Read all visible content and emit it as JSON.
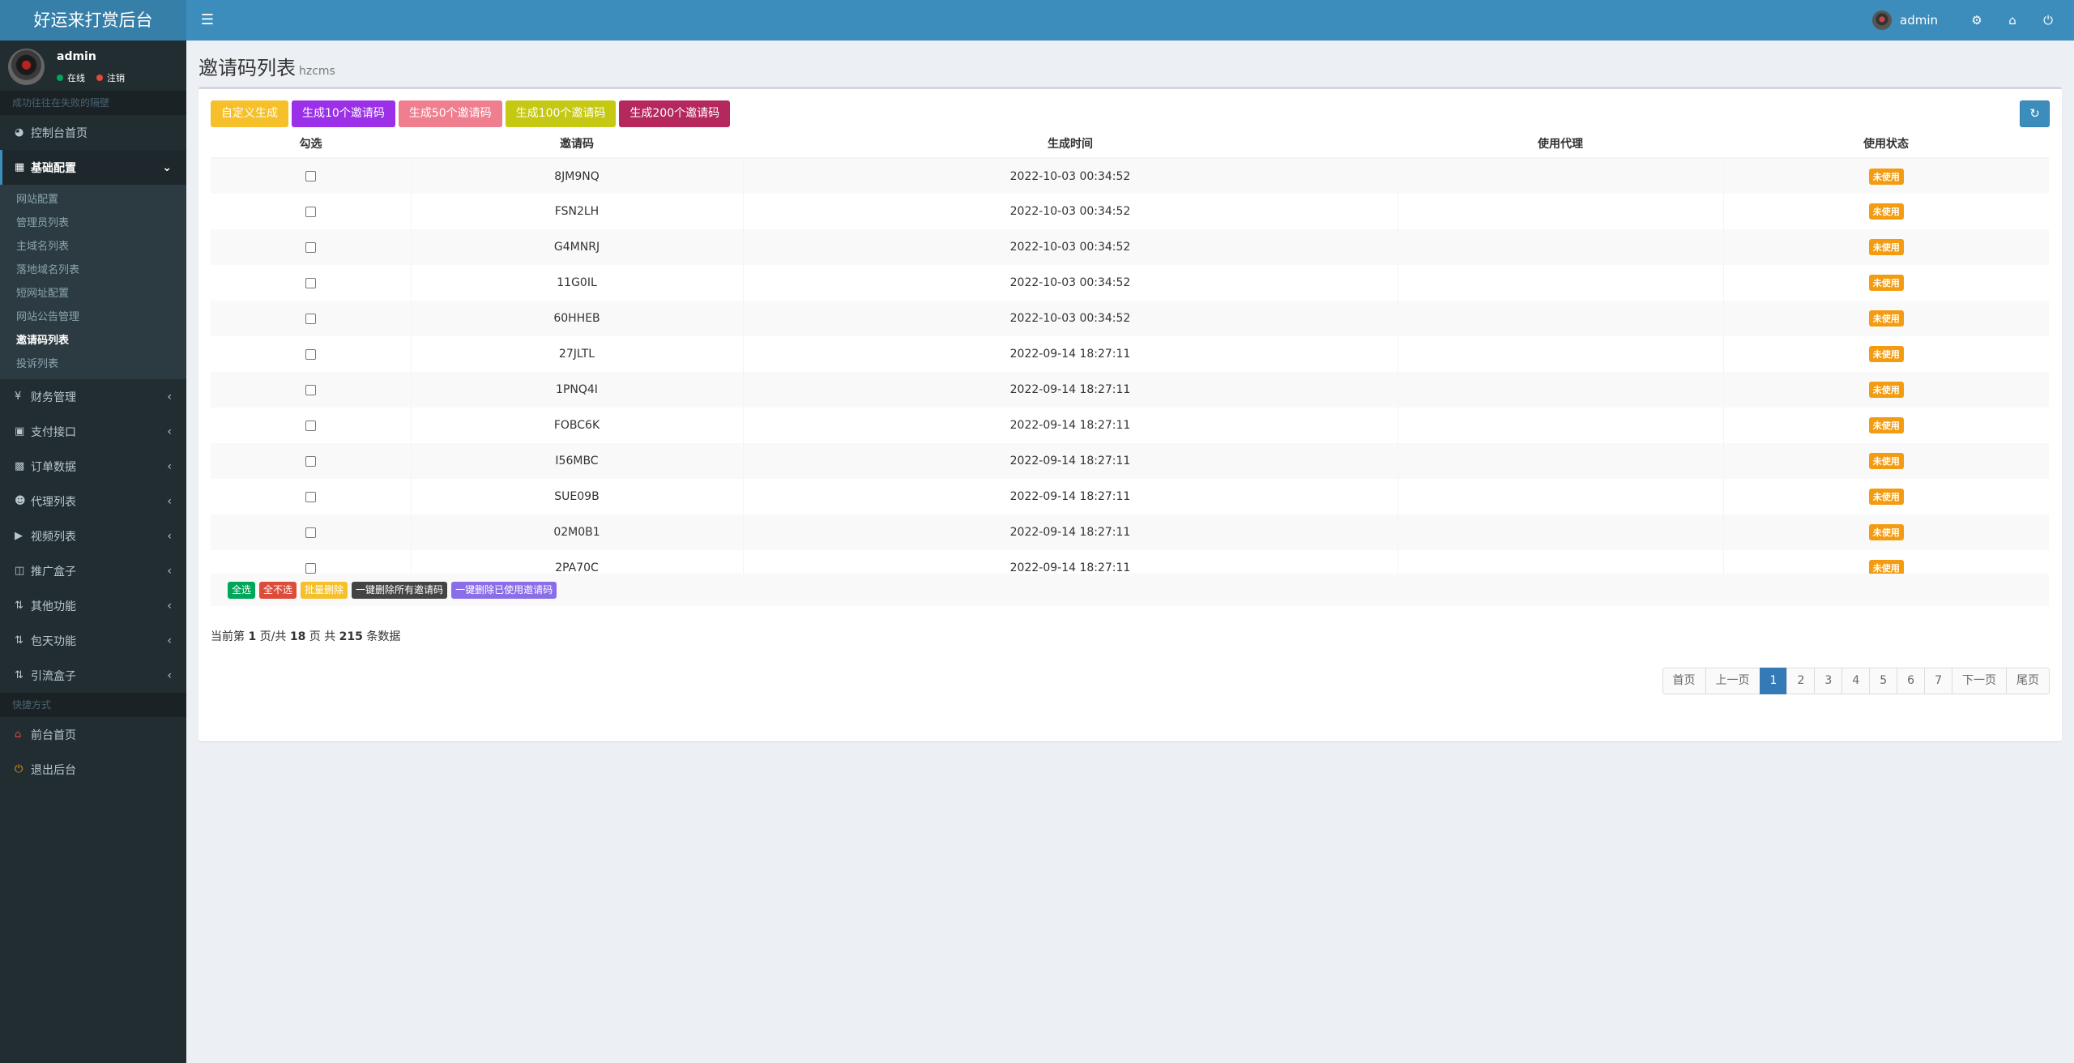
{
  "header": {
    "logo": "好运来打赏后台",
    "user": "admin"
  },
  "sidebar": {
    "user_name": "admin",
    "status_online": "在线",
    "status_logout": "注销",
    "hint": "成功往往在失败的隔壁",
    "items": [
      {
        "label": "控制台首页",
        "icon": "dashboard-icon"
      },
      {
        "label": "基础配置",
        "icon": "grid-icon"
      },
      {
        "label": "财务管理",
        "icon": "yen-icon"
      },
      {
        "label": "支付接口",
        "icon": "payment-icon"
      },
      {
        "label": "订单数据",
        "icon": "bar-chart-icon"
      },
      {
        "label": "代理列表",
        "icon": "users-icon"
      },
      {
        "label": "视频列表",
        "icon": "video-icon"
      },
      {
        "label": "推广盒子",
        "icon": "table-icon"
      },
      {
        "label": "其他功能",
        "icon": "retweet-icon"
      },
      {
        "label": "包天功能",
        "icon": "retweet-icon"
      },
      {
        "label": "引流盒子",
        "icon": "retweet-icon"
      }
    ],
    "submenu": [
      "网站配置",
      "管理员列表",
      "主域名列表",
      "落地域名列表",
      "短网址配置",
      "网站公告管理",
      "邀请码列表",
      "投诉列表"
    ],
    "quick_label": "快捷方式",
    "quick": [
      "前台首页",
      "退出后台"
    ]
  },
  "page": {
    "title": "邀请码列表",
    "subtitle": "hzcms"
  },
  "toolbar": {
    "buttons": [
      "自定义生成",
      "生成10个邀请码",
      "生成50个邀请码",
      "生成100个邀请码",
      "生成200个邀请码"
    ],
    "colors": [
      "#f6c02b",
      "#9b30e8",
      "#ef7f8f",
      "#c6c913",
      "#b5285d"
    ]
  },
  "table": {
    "headers": [
      "勾选",
      "邀请码",
      "生成时间",
      "使用代理",
      "使用状态"
    ],
    "rows": [
      {
        "code": "8JM9NQ",
        "time": "2022-10-03 00:34:52",
        "agent": "",
        "status": "未使用"
      },
      {
        "code": "FSN2LH",
        "time": "2022-10-03 00:34:52",
        "agent": "",
        "status": "未使用"
      },
      {
        "code": "G4MNRJ",
        "time": "2022-10-03 00:34:52",
        "agent": "",
        "status": "未使用"
      },
      {
        "code": "11G0IL",
        "time": "2022-10-03 00:34:52",
        "agent": "",
        "status": "未使用"
      },
      {
        "code": "60HHEB",
        "time": "2022-10-03 00:34:52",
        "agent": "",
        "status": "未使用"
      },
      {
        "code": "27JLTL",
        "time": "2022-09-14 18:27:11",
        "agent": "",
        "status": "未使用"
      },
      {
        "code": "1PNQ4I",
        "time": "2022-09-14 18:27:11",
        "agent": "",
        "status": "未使用"
      },
      {
        "code": "FOBC6K",
        "time": "2022-09-14 18:27:11",
        "agent": "",
        "status": "未使用"
      },
      {
        "code": "I56MBC",
        "time": "2022-09-14 18:27:11",
        "agent": "",
        "status": "未使用"
      },
      {
        "code": "SUE09B",
        "time": "2022-09-14 18:27:11",
        "agent": "",
        "status": "未使用"
      },
      {
        "code": "02M0B1",
        "time": "2022-09-14 18:27:11",
        "agent": "",
        "status": "未使用"
      },
      {
        "code": "2PA70C",
        "time": "2022-09-14 18:27:11",
        "agent": "",
        "status": "未使用"
      }
    ]
  },
  "actions": {
    "buttons": [
      "全选",
      "全不选",
      "批量删除",
      "一键删除所有邀请码",
      "一键删除已使用邀请码"
    ],
    "colors": [
      "#00a65a",
      "#dd4b39",
      "#f6c02b",
      "#444444",
      "#8a6ee8"
    ]
  },
  "pageinfo": {
    "prefix": "当前第 ",
    "current": "1",
    "mid1": " 页/共 ",
    "total_pages": "18",
    "mid2": " 页 共 ",
    "total_items": "215",
    "suffix": " 条数据"
  },
  "pagination": [
    "首页",
    "上一页",
    "1",
    "2",
    "3",
    "4",
    "5",
    "6",
    "7",
    "下一页",
    "尾页"
  ],
  "pagination_active": "1"
}
